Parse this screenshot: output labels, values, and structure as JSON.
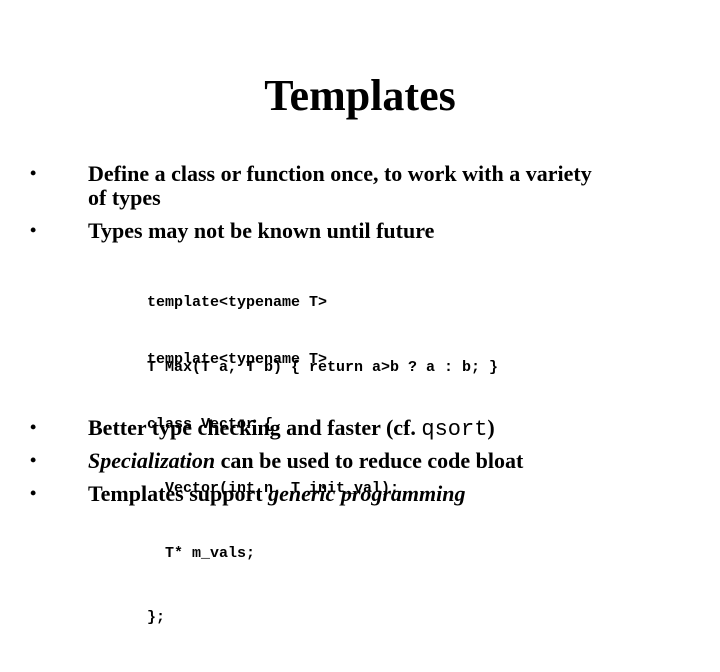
{
  "slide": {
    "title": "Templates",
    "bullets_top": [
      {
        "marker": "•",
        "lines": [
          "Define a class or function once, to work with a variety",
          "of types"
        ]
      },
      {
        "marker": "•",
        "lines": [
          "Types may not be known until future"
        ]
      }
    ],
    "code_blocks": [
      {
        "lines": [
          "template<typename T>",
          "T Max(T a, T b) { return a>b ? a : b; }"
        ]
      },
      {
        "lines": [
          "template<typename T>",
          "class Vector {",
          "  Vector(int n, T init_val);",
          "  T* m_vals;",
          "};"
        ]
      }
    ],
    "bullets_bottom": [
      {
        "marker": "•",
        "text_before": "Better type checking and faster (cf. ",
        "code": "qsort",
        "text_after": ")"
      },
      {
        "marker": "•",
        "emphasis": "Specialization",
        "text_after": " can be used to reduce code bloat"
      },
      {
        "marker": "•",
        "text_before": "Templates support ",
        "emphasis": "generic programming"
      }
    ]
  }
}
